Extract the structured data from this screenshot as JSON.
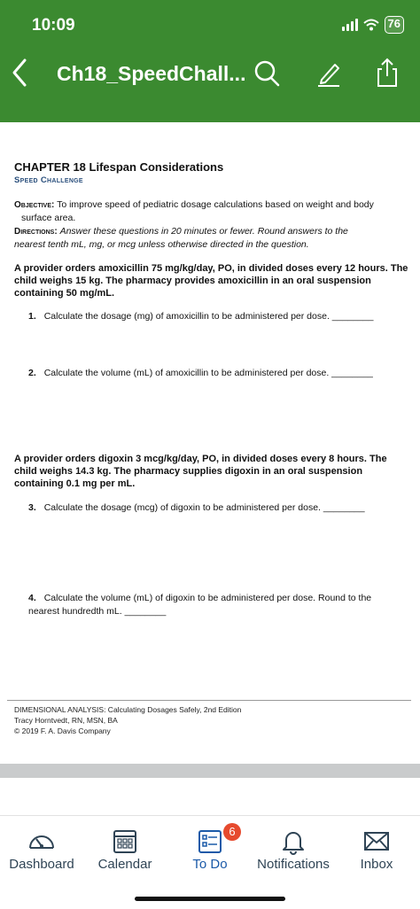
{
  "status": {
    "time": "10:09",
    "battery": "76"
  },
  "nav": {
    "title": "Ch18_SpeedChall..."
  },
  "document": {
    "chapter_title": "CHAPTER 18 Lifespan Considerations",
    "chapter_subtitle": "Speed Challenge",
    "objective_label": "Objective:",
    "objective_text": "To improve speed of pediatric dosage calculations based on weight and body",
    "objective_text_2": "surface area.",
    "directions_label": "Directions:",
    "directions_text": "Answer these questions in 20 minutes or fewer. Round answers to the",
    "directions_text_2": "nearest tenth mL, mg, or mcg unless otherwise directed in the question.",
    "problem1": "A provider orders amoxicillin 75 mg/kg/day, PO, in divided doses every 12 hours. The child weighs 15 kg. The pharmacy provides amoxicillin in an oral suspension containing 50 mg/mL.",
    "problem2": "A provider orders digoxin 3 mcg/kg/day, PO, in divided doses every 8 hours. The child weighs 14.3 kg. The pharmacy supplies digoxin in an oral suspension containing 0.1 mg per mL.",
    "questions": [
      {
        "num": "1.",
        "text": "Calculate the dosage (mg) of amoxicillin to be administered per dose. ________"
      },
      {
        "num": "2.",
        "text": "Calculate the volume (mL) of amoxicillin to be administered per dose. ________"
      },
      {
        "num": "3.",
        "text": "Calculate the dosage (mcg) of digoxin to be administered per dose. ________"
      },
      {
        "num": "4.",
        "text": "Calculate the volume (mL) of digoxin to be administered per dose. Round to the nearest hundredth mL. ________"
      }
    ],
    "footer": {
      "line1": "DIMENSIONAL ANALYSIS: Calculating Dosages Safely, 2nd Edition",
      "line2": "Tracy Horntvedt, RN, MSN, BA",
      "line3": "© 2019 F. A. Davis Company"
    }
  },
  "tabs": [
    {
      "label": "Dashboard",
      "icon": "dashboard-icon"
    },
    {
      "label": "Calendar",
      "icon": "calendar-icon"
    },
    {
      "label": "To Do",
      "icon": "todo-icon",
      "badge": "6"
    },
    {
      "label": "Notifications",
      "icon": "bell-icon"
    },
    {
      "label": "Inbox",
      "icon": "inbox-icon"
    }
  ],
  "colors": {
    "header": "#3b8a30",
    "active_tab": "#1b5aa8",
    "badge": "#e64a2e"
  }
}
